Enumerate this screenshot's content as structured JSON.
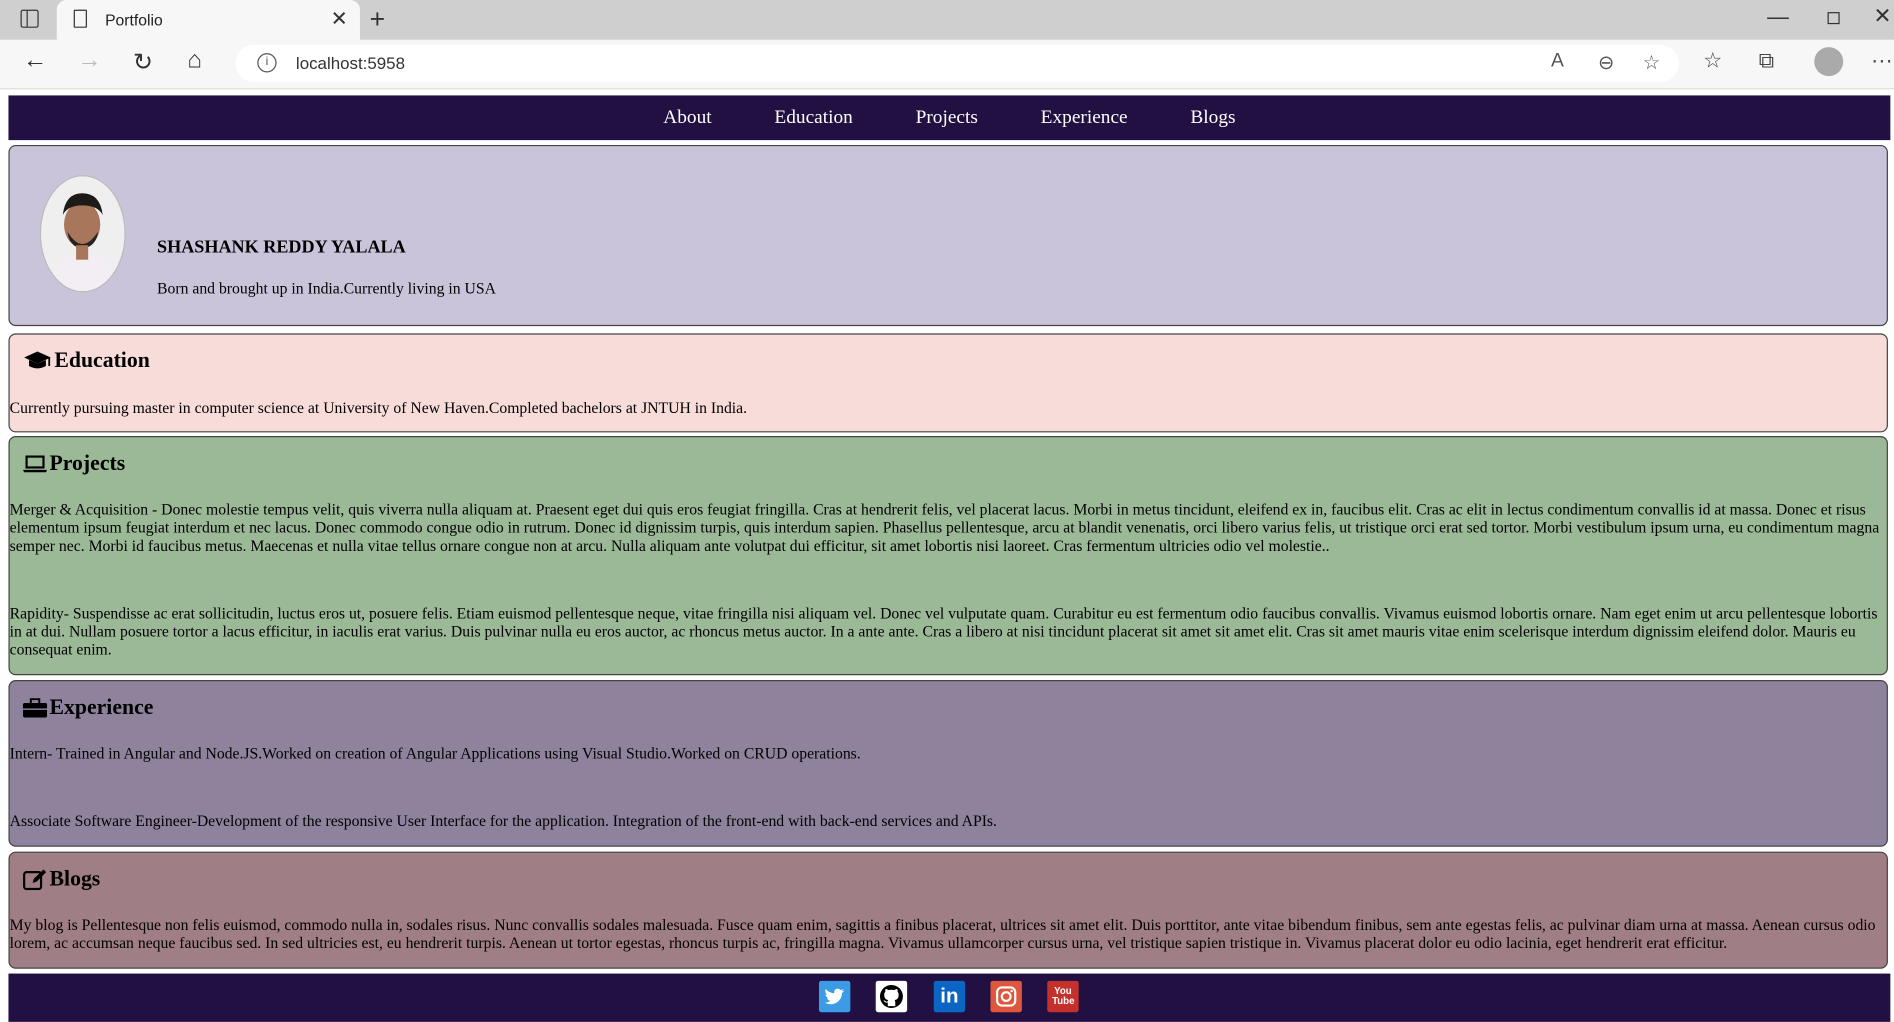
{
  "browser": {
    "tab_title": "Portfolio",
    "url": "localhost:5958"
  },
  "nav": {
    "items": [
      "About",
      "Education",
      "Projects",
      "Experience",
      "Blogs"
    ]
  },
  "profile": {
    "name": "SHASHANK REDDY YALALA",
    "bio": "Born and brought up in India.Currently living in USA"
  },
  "education": {
    "title": "Education",
    "text": "Currently pursuing master in computer science at University of New Haven.Completed bachelors at JNTUH in India."
  },
  "projects": {
    "title": "Projects",
    "items": [
      "Merger & Acquisition - Donec molestie tempus velit, quis viverra nulla aliquam at. Praesent eget dui quis eros feugiat fringilla. Cras at hendrerit felis, vel placerat lacus. Morbi in metus tincidunt, eleifend ex in, faucibus elit. Cras ac elit in lectus condimentum convallis id at massa. Donec et risus elementum ipsum feugiat interdum et nec lacus. Donec commodo congue odio in rutrum. Donec id dignissim turpis, quis interdum sapien. Phasellus pellentesque, arcu at blandit venenatis, orci libero varius felis, ut tristique orci erat sed tortor. Morbi vestibulum ipsum urna, eu condimentum magna semper nec. Morbi id faucibus metus. Maecenas et nulla vitae tellus ornare congue non at arcu. Nulla aliquam ante volutpat dui efficitur, sit amet lobortis nisi laoreet. Cras fermentum ultricies odio vel molestie..",
      "Rapidity- Suspendisse ac erat sollicitudin, luctus eros ut, posuere felis. Etiam euismod pellentesque neque, vitae fringilla nisi aliquam vel. Donec vel vulputate quam. Curabitur eu est fermentum odio faucibus convallis. Vivamus euismod lobortis ornare. Nam eget enim ut arcu pellentesque lobortis in at dui. Nullam posuere tortor a lacus efficitur, in iaculis erat varius. Duis pulvinar nulla eu eros auctor, ac rhoncus metus auctor. In a ante ante. Cras a libero at nisi tincidunt placerat sit amet sit amet elit. Cras sit amet mauris vitae enim scelerisque interdum dignissim eleifend dolor. Mauris eu consequat enim."
    ]
  },
  "experience": {
    "title": "Experience",
    "items": [
      "Intern- Trained in Angular and Node.JS.Worked on creation of Angular Applications using Visual Studio.Worked on CRUD operations.",
      "Associate Software Engineer-Development of the responsive User Interface for the application. Integration of the front-end with back-end services and APIs."
    ]
  },
  "blogs": {
    "title": "Blogs",
    "text": "My blog is Pellentesque non felis euismod, commodo nulla in, sodales risus. Nunc convallis sodales malesuada. Fusce quam enim, sagittis a finibus placerat, ultrices sit amet elit. Duis porttitor, ante vitae bibendum finibus, sem ante egestas felis, ac pulvinar diam urna at massa. Aenean cursus odio lorem, ac accumsan neque faucibus sed. In sed ultricies est, eu hendrerit turpis. Aenean ut tortor egestas, rhoncus turpis ac, fringilla magna. Vivamus ullamcorper cursus urna, vel tristique sapien tristique in. Vivamus placerat dolor eu odio lacinia, eget hendrerit erat efficitur."
  },
  "social": {
    "icons": [
      "twitter-icon",
      "github-icon",
      "linkedin-icon",
      "instagram-icon",
      "youtube-icon"
    ],
    "linkedin_label": "in",
    "youtube_label": "You Tube",
    "colors": {
      "twitter": "#3b9be4",
      "github": "#ffffff",
      "linkedin": "#0a66c2",
      "instagram": "#e0563b",
      "youtube": "#c4302b"
    }
  },
  "colors": {
    "nav_bg": "#221043",
    "hero_bg": "#c9c4d9",
    "education_bg": "#f8dcda",
    "projects_bg": "#9bb897",
    "experience_bg": "#8f829d",
    "blogs_bg": "#a07e86"
  }
}
